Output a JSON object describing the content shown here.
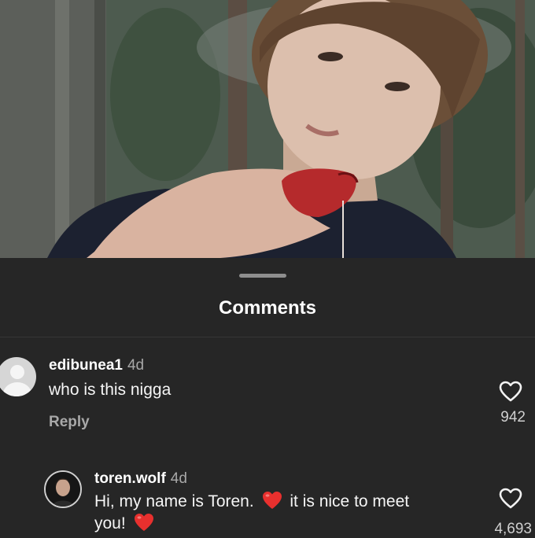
{
  "sheet": {
    "title": "Comments"
  },
  "comments": [
    {
      "username": "edibunea1",
      "time": "4d",
      "text": "who is this nigga",
      "reply_label": "Reply",
      "likes": "942",
      "avatar_icon": "default-avatar-icon",
      "like_icon": "heart-outline-icon"
    },
    {
      "username": "toren.wolf",
      "time": "4d",
      "text_part1": "Hi, my name is Toren.",
      "text_part2": "it is nice to meet",
      "text_part3": "you!",
      "emoji_icon": "red-heart-emoji-icon",
      "likes": "4,693",
      "like_icon": "heart-outline-icon"
    }
  ],
  "colors": {
    "sheet_bg": "#262626",
    "secondary_text": "#a8a8a8",
    "heart_emoji": "#e8302e"
  }
}
